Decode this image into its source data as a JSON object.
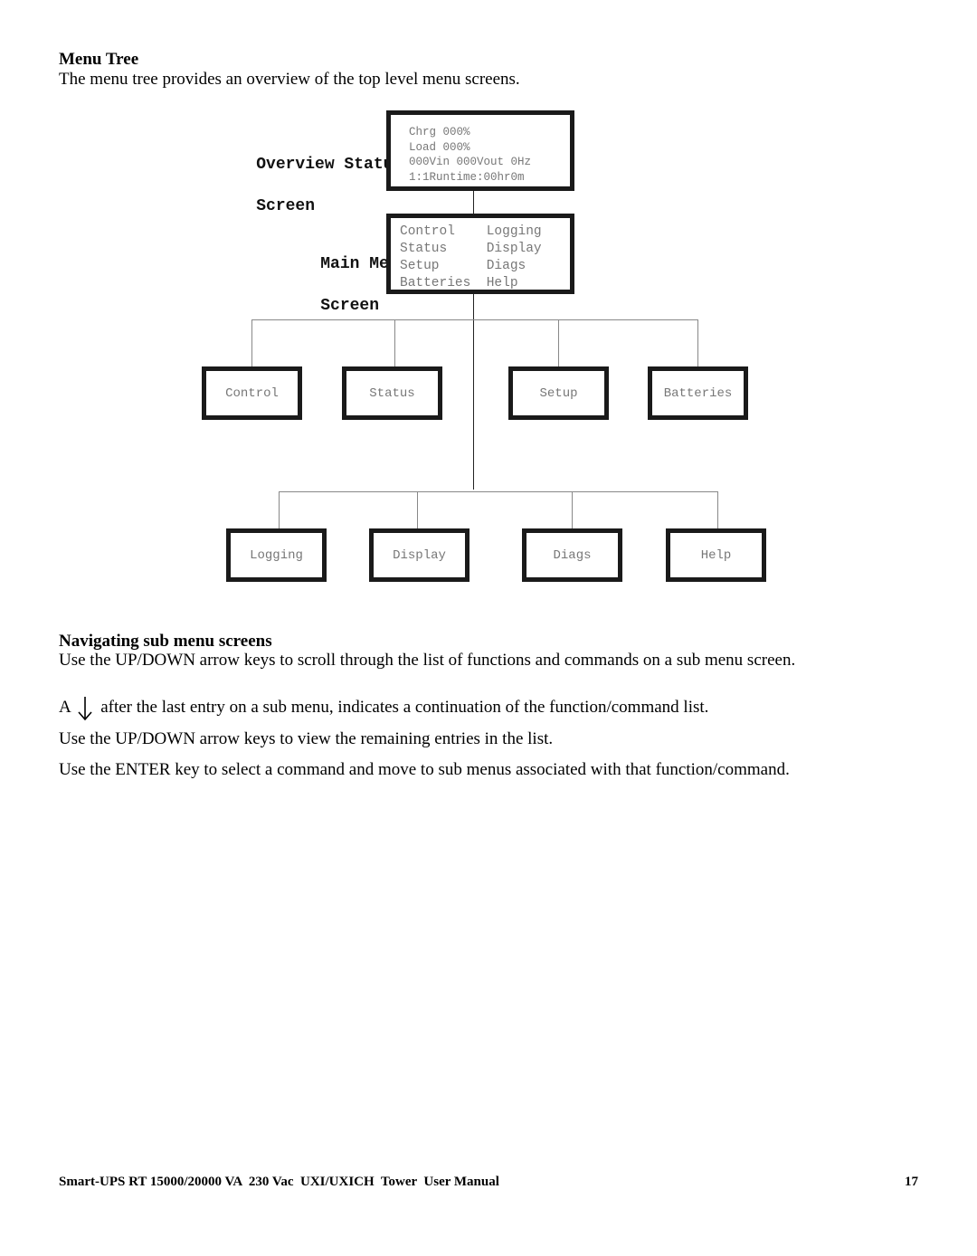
{
  "section_title": "Menu Tree",
  "intro": "The menu tree provides an overview of the top level menu screens.",
  "overview": {
    "label_line1": "Overview Status",
    "label_line2": "Screen",
    "lines": [
      "Chrg 000%",
      "Load 000%",
      "000Vin 000Vout 0Hz",
      "1:1Runtime:00hr0m"
    ]
  },
  "main_menu": {
    "label_line1": "Main Menu",
    "label_line2": "Screen",
    "lines": [
      "Control    Logging",
      "Status     Display",
      "Setup      Diags",
      "Batteries  Help"
    ]
  },
  "submenus_row1": [
    "Control",
    "Status",
    "Setup",
    "Batteries"
  ],
  "submenus_row2": [
    "Logging",
    "Display",
    "Diags",
    "Help"
  ],
  "nav_title": "Navigating sub menu screens",
  "nav_para1": "Use the UP/DOWN arrow keys to scroll through the list of functions and commands on a sub menu screen.",
  "nav_para2_prefix": "A",
  "nav_para2_icon": "down-arrow-icon",
  "nav_para2_suffix": "after the last entry on a sub menu, indicates a continuation of the function/command list.",
  "nav_para3": "Use the UP/DOWN arrow keys to view the remaining entries in the list.",
  "nav_para4": "Use the ENTER key to select a command and move to sub menus associated with that function/command.",
  "footer": {
    "manual_title": "Smart-UPS RT 15000/20000 VA  230 Vac  UXI/UXICH  Tower  User Manual",
    "page_number": "17"
  }
}
